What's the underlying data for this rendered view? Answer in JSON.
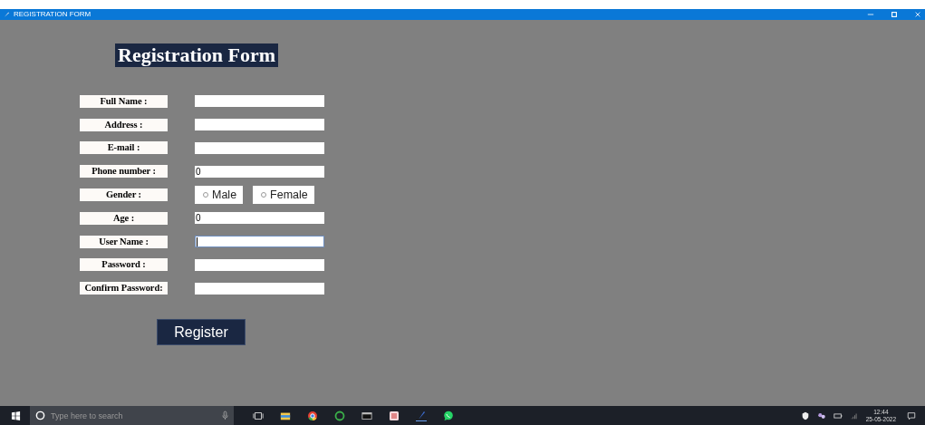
{
  "window": {
    "title": "REGISTRATION FORM"
  },
  "heading": "Registration Form",
  "fields": [
    {
      "label": "Full Name :",
      "kind": "text",
      "focused": false
    },
    {
      "label": "Address :",
      "kind": "text",
      "focused": false
    },
    {
      "label": "E-mail :",
      "kind": "text",
      "focused": false
    },
    {
      "label": "Phone number :",
      "kind": "text",
      "value": "0",
      "focused": false
    },
    {
      "label": "Gender :",
      "kind": "radio",
      "options": [
        {
          "label": "Male",
          "selected": false
        },
        {
          "label": "Female",
          "selected": false
        }
      ]
    },
    {
      "label": "Age :",
      "kind": "text",
      "value": "0",
      "focused": false
    },
    {
      "label": "User Name :",
      "kind": "text",
      "focused": true
    },
    {
      "label": "Password :",
      "kind": "text",
      "focused": false
    },
    {
      "label": "Confirm Password:",
      "kind": "text",
      "focused": false
    }
  ],
  "register_button": "Register",
  "taskbar": {
    "search_placeholder": "Type here to search",
    "time": "12:44",
    "date": "25-05-2022"
  }
}
